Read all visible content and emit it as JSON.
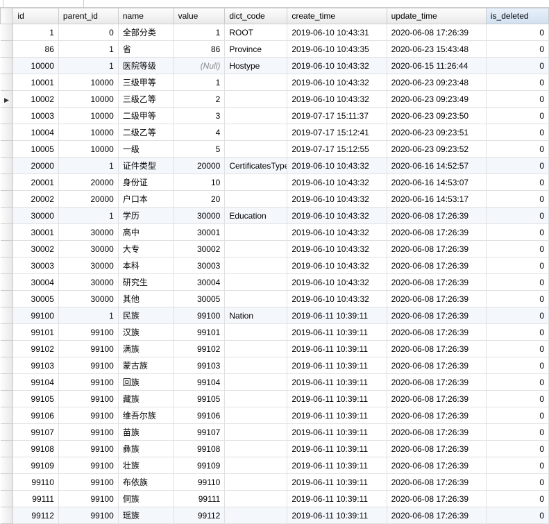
{
  "columns": {
    "indicator": "",
    "id": "id",
    "parent_id": "parent_id",
    "name": "name",
    "value": "value",
    "dict_code": "dict_code",
    "create_time": "create_time",
    "update_time": "update_time",
    "is_deleted": "is_deleted"
  },
  "null_label": "(Null)",
  "current_row_index": 5,
  "rows": [
    {
      "id": "1",
      "parent_id": "0",
      "name": "全部分类",
      "value": "1",
      "dict_code": "ROOT",
      "create_time": "2019-06-10 10:43:31",
      "update_time": "2020-06-08 17:26:39",
      "is_deleted": "0"
    },
    {
      "id": "86",
      "parent_id": "1",
      "name": "省",
      "value": "86",
      "dict_code": "Province",
      "create_time": "2019-06-10 10:43:35",
      "update_time": "2020-06-23 15:43:48",
      "is_deleted": "0"
    },
    {
      "id": "10000",
      "parent_id": "1",
      "name": "医院等级",
      "value": null,
      "dict_code": "Hostype",
      "create_time": "2019-06-10 10:43:32",
      "update_time": "2020-06-15 11:26:44",
      "is_deleted": "0",
      "alt": true
    },
    {
      "id": "10001",
      "parent_id": "10000",
      "name": "三级甲等",
      "value": "1",
      "dict_code": "",
      "create_time": "2019-06-10 10:43:32",
      "update_time": "2020-06-23 09:23:48",
      "is_deleted": "0"
    },
    {
      "id": "10002",
      "parent_id": "10000",
      "name": "三级乙等",
      "value": "2",
      "dict_code": "",
      "create_time": "2019-06-10 10:43:32",
      "update_time": "2020-06-23 09:23:49",
      "is_deleted": "0"
    },
    {
      "id": "10003",
      "parent_id": "10000",
      "name": "二级甲等",
      "value": "3",
      "dict_code": "",
      "create_time": "2019-07-17 15:11:37",
      "update_time": "2020-06-23 09:23:50",
      "is_deleted": "0"
    },
    {
      "id": "10004",
      "parent_id": "10000",
      "name": "二级乙等",
      "value": "4",
      "dict_code": "",
      "create_time": "2019-07-17 15:12:41",
      "update_time": "2020-06-23 09:23:51",
      "is_deleted": "0"
    },
    {
      "id": "10005",
      "parent_id": "10000",
      "name": "一级",
      "value": "5",
      "dict_code": "",
      "create_time": "2019-07-17 15:12:55",
      "update_time": "2020-06-23 09:23:52",
      "is_deleted": "0"
    },
    {
      "id": "20000",
      "parent_id": "1",
      "name": "证件类型",
      "value": "20000",
      "dict_code": "CertificatesType",
      "create_time": "2019-06-10 10:43:32",
      "update_time": "2020-06-16 14:52:57",
      "is_deleted": "0",
      "alt": true
    },
    {
      "id": "20001",
      "parent_id": "20000",
      "name": "身份证",
      "value": "10",
      "dict_code": "",
      "create_time": "2019-06-10 10:43:32",
      "update_time": "2020-06-16 14:53:07",
      "is_deleted": "0"
    },
    {
      "id": "20002",
      "parent_id": "20000",
      "name": "户口本",
      "value": "20",
      "dict_code": "",
      "create_time": "2019-06-10 10:43:32",
      "update_time": "2020-06-16 14:53:17",
      "is_deleted": "0"
    },
    {
      "id": "30000",
      "parent_id": "1",
      "name": "学历",
      "value": "30000",
      "dict_code": "Education",
      "create_time": "2019-06-10 10:43:32",
      "update_time": "2020-06-08 17:26:39",
      "is_deleted": "0",
      "alt": true
    },
    {
      "id": "30001",
      "parent_id": "30000",
      "name": "高中",
      "value": "30001",
      "dict_code": "",
      "create_time": "2019-06-10 10:43:32",
      "update_time": "2020-06-08 17:26:39",
      "is_deleted": "0"
    },
    {
      "id": "30002",
      "parent_id": "30000",
      "name": "大专",
      "value": "30002",
      "dict_code": "",
      "create_time": "2019-06-10 10:43:32",
      "update_time": "2020-06-08 17:26:39",
      "is_deleted": "0"
    },
    {
      "id": "30003",
      "parent_id": "30000",
      "name": "本科",
      "value": "30003",
      "dict_code": "",
      "create_time": "2019-06-10 10:43:32",
      "update_time": "2020-06-08 17:26:39",
      "is_deleted": "0"
    },
    {
      "id": "30004",
      "parent_id": "30000",
      "name": "研究生",
      "value": "30004",
      "dict_code": "",
      "create_time": "2019-06-10 10:43:32",
      "update_time": "2020-06-08 17:26:39",
      "is_deleted": "0"
    },
    {
      "id": "30005",
      "parent_id": "30000",
      "name": "其他",
      "value": "30005",
      "dict_code": "",
      "create_time": "2019-06-10 10:43:32",
      "update_time": "2020-06-08 17:26:39",
      "is_deleted": "0"
    },
    {
      "id": "99100",
      "parent_id": "1",
      "name": "民族",
      "value": "99100",
      "dict_code": "Nation",
      "create_time": "2019-06-11 10:39:11",
      "update_time": "2020-06-08 17:26:39",
      "is_deleted": "0",
      "alt": true
    },
    {
      "id": "99101",
      "parent_id": "99100",
      "name": "汉族",
      "value": "99101",
      "dict_code": "",
      "create_time": "2019-06-11 10:39:11",
      "update_time": "2020-06-08 17:26:39",
      "is_deleted": "0"
    },
    {
      "id": "99102",
      "parent_id": "99100",
      "name": "满族",
      "value": "99102",
      "dict_code": "",
      "create_time": "2019-06-11 10:39:11",
      "update_time": "2020-06-08 17:26:39",
      "is_deleted": "0"
    },
    {
      "id": "99103",
      "parent_id": "99100",
      "name": "蒙古族",
      "value": "99103",
      "dict_code": "",
      "create_time": "2019-06-11 10:39:11",
      "update_time": "2020-06-08 17:26:39",
      "is_deleted": "0"
    },
    {
      "id": "99104",
      "parent_id": "99100",
      "name": "回族",
      "value": "99104",
      "dict_code": "",
      "create_time": "2019-06-11 10:39:11",
      "update_time": "2020-06-08 17:26:39",
      "is_deleted": "0"
    },
    {
      "id": "99105",
      "parent_id": "99100",
      "name": "藏族",
      "value": "99105",
      "dict_code": "",
      "create_time": "2019-06-11 10:39:11",
      "update_time": "2020-06-08 17:26:39",
      "is_deleted": "0"
    },
    {
      "id": "99106",
      "parent_id": "99100",
      "name": "维吾尔族",
      "value": "99106",
      "dict_code": "",
      "create_time": "2019-06-11 10:39:11",
      "update_time": "2020-06-08 17:26:39",
      "is_deleted": "0"
    },
    {
      "id": "99107",
      "parent_id": "99100",
      "name": "苗族",
      "value": "99107",
      "dict_code": "",
      "create_time": "2019-06-11 10:39:11",
      "update_time": "2020-06-08 17:26:39",
      "is_deleted": "0"
    },
    {
      "id": "99108",
      "parent_id": "99100",
      "name": "彝族",
      "value": "99108",
      "dict_code": "",
      "create_time": "2019-06-11 10:39:11",
      "update_time": "2020-06-08 17:26:39",
      "is_deleted": "0"
    },
    {
      "id": "99109",
      "parent_id": "99100",
      "name": "壮族",
      "value": "99109",
      "dict_code": "",
      "create_time": "2019-06-11 10:39:11",
      "update_time": "2020-06-08 17:26:39",
      "is_deleted": "0"
    },
    {
      "id": "99110",
      "parent_id": "99100",
      "name": "布依族",
      "value": "99110",
      "dict_code": "",
      "create_time": "2019-06-11 10:39:11",
      "update_time": "2020-06-08 17:26:39",
      "is_deleted": "0"
    },
    {
      "id": "99111",
      "parent_id": "99100",
      "name": "侗族",
      "value": "99111",
      "dict_code": "",
      "create_time": "2019-06-11 10:39:11",
      "update_time": "2020-06-08 17:26:39",
      "is_deleted": "0"
    },
    {
      "id": "99112",
      "parent_id": "99100",
      "name": "瑶族",
      "value": "99112",
      "dict_code": "",
      "create_time": "2019-06-11 10:39:11",
      "update_time": "2020-06-08 17:26:39",
      "is_deleted": "0",
      "alt": true
    }
  ]
}
